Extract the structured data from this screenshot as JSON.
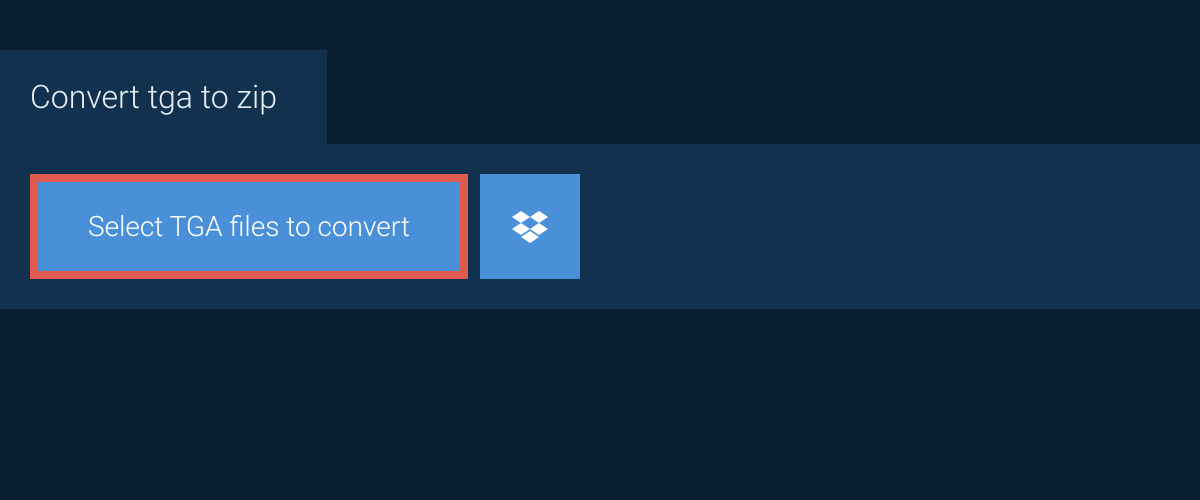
{
  "tab": {
    "title": "Convert tga to zip"
  },
  "actions": {
    "select_files_label": "Select TGA files to convert"
  },
  "colors": {
    "background": "#0a1f33",
    "panel": "#12314f",
    "button": "#4a90d9",
    "highlight_border": "#e05a4f",
    "text_light": "#e8eef3",
    "text_white": "#ffffff"
  }
}
